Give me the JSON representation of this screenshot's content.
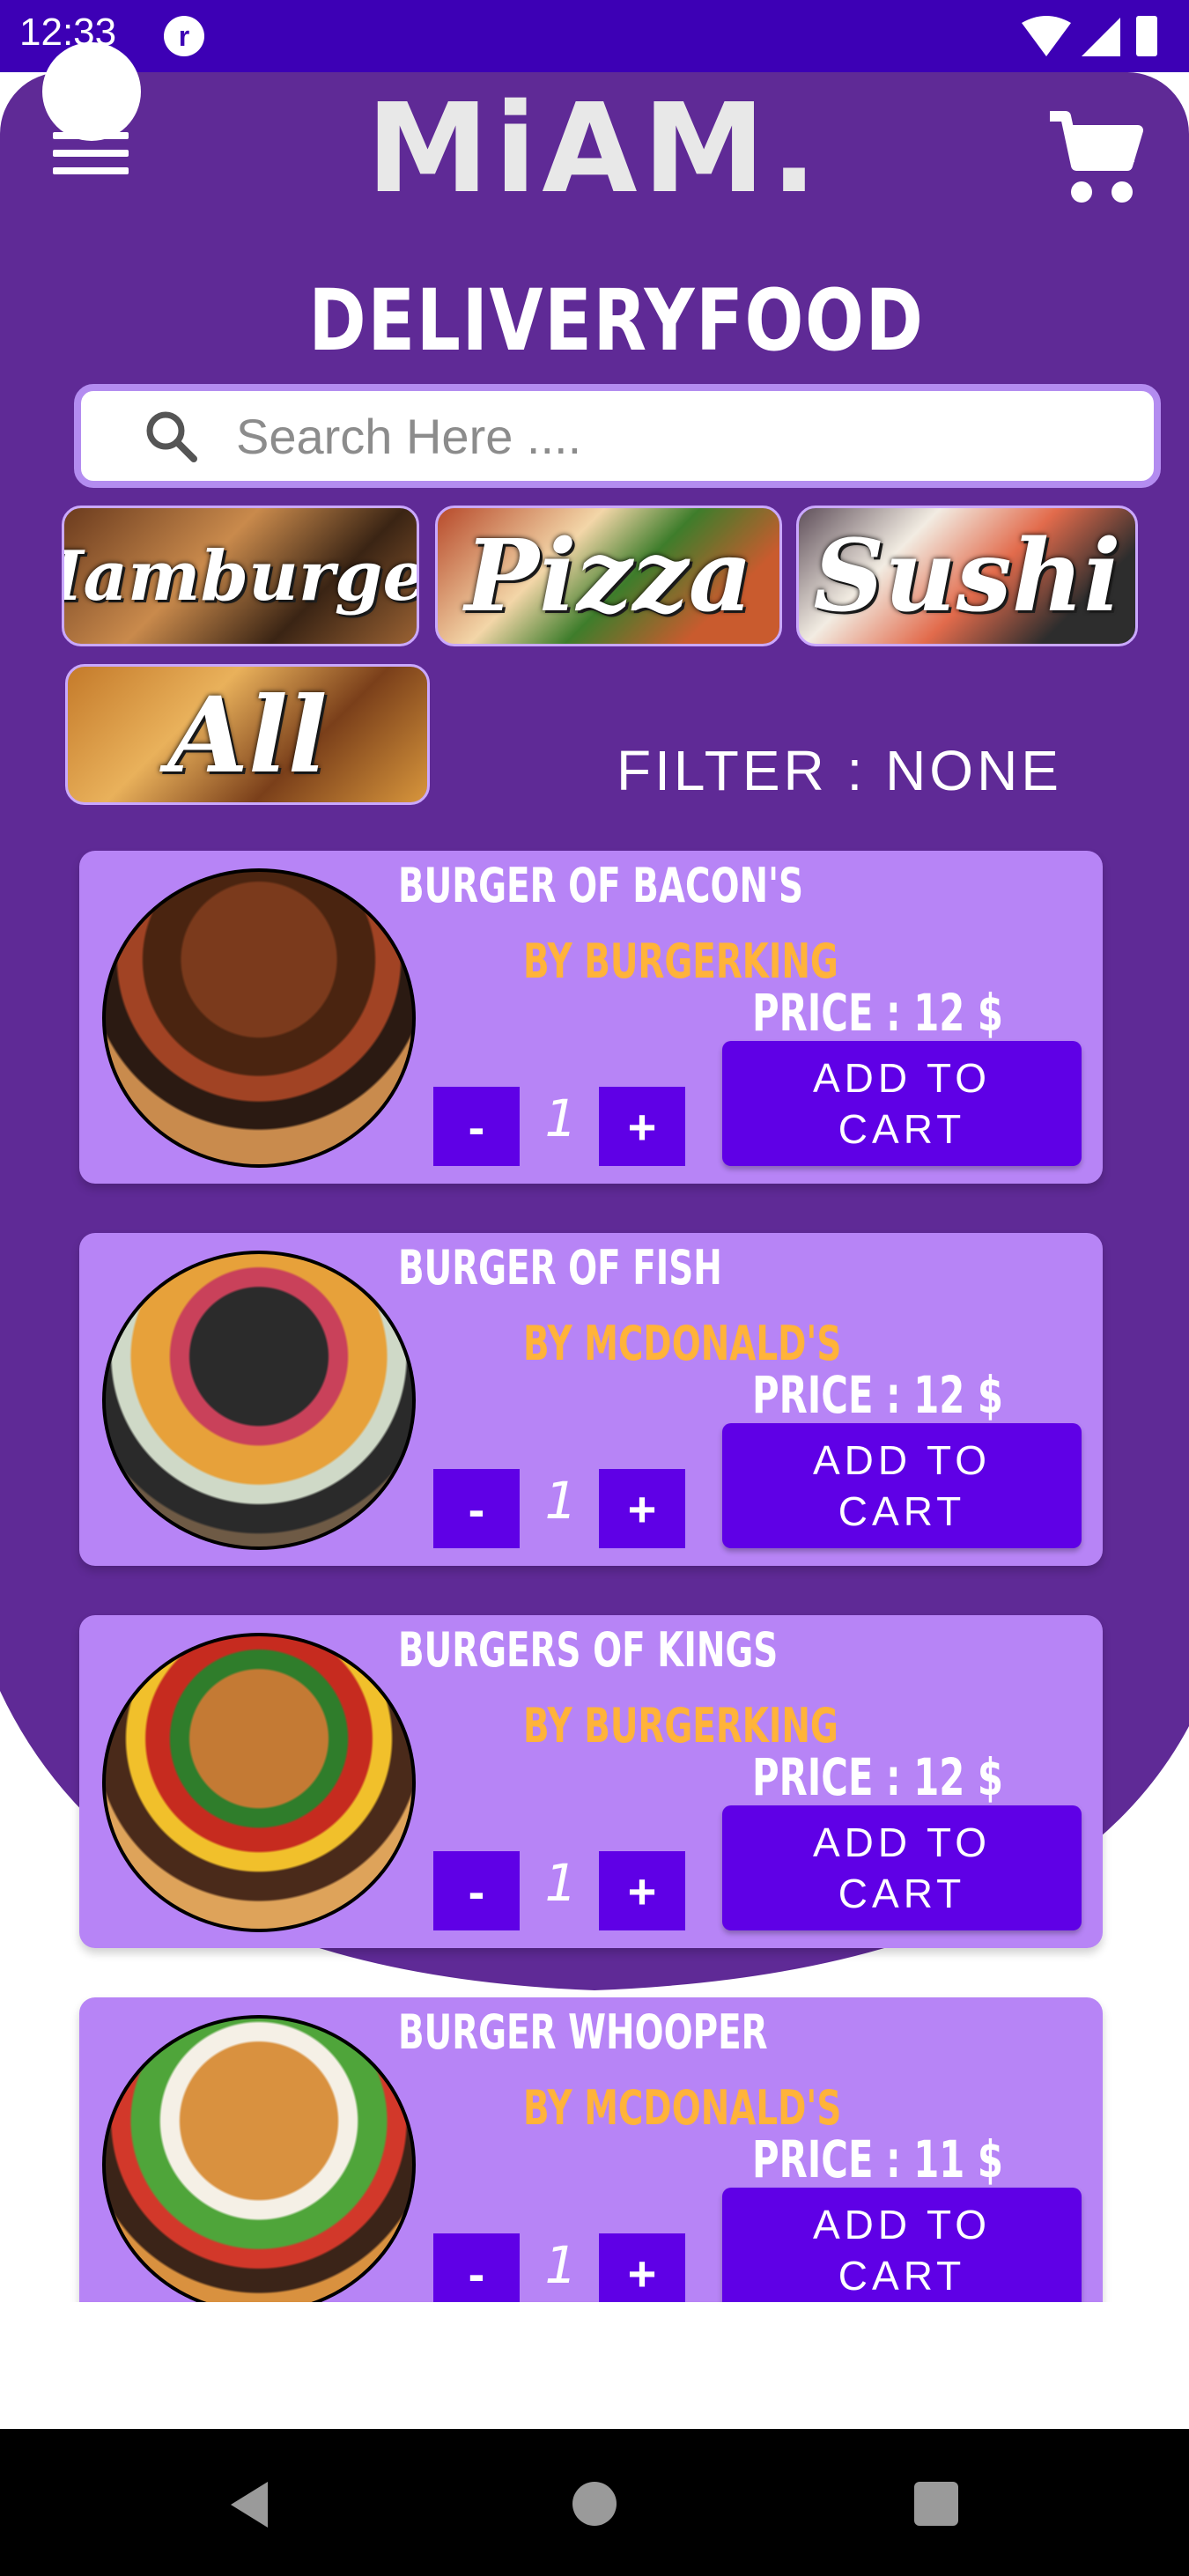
{
  "status_bar": {
    "time": "12:33",
    "app_badge": "r"
  },
  "header": {
    "logo": "MiAM.",
    "title": "DELIVERYFOOD"
  },
  "search": {
    "placeholder": "Search Here ...."
  },
  "categories": [
    {
      "label": "Hamburger"
    },
    {
      "label": "Pizza"
    },
    {
      "label": "Sushi"
    },
    {
      "label": "All"
    }
  ],
  "filter": {
    "text": "FILTER : NONE"
  },
  "products": [
    {
      "name": "BURGER OF BACON'S",
      "vendor": "BY BURGERKING",
      "price": "PRICE :  12 $",
      "qty": "1",
      "minus": "-",
      "plus": "+",
      "add_label": "ADD TO CART"
    },
    {
      "name": "BURGER OF FISH",
      "vendor": "BY MCDONALD'S",
      "price": "PRICE :  12 $",
      "qty": "1",
      "minus": "-",
      "plus": "+",
      "add_label": "ADD TO CART"
    },
    {
      "name": "BURGERS OF KINGS",
      "vendor": "BY BURGERKING",
      "price": "PRICE :  12 $",
      "qty": "1",
      "minus": "-",
      "plus": "+",
      "add_label": "ADD TO CART"
    },
    {
      "name": "BURGER WHOOPER",
      "vendor": "BY MCDONALD'S",
      "price": "PRICE :  11 $",
      "qty": "1",
      "minus": "-",
      "plus": "+",
      "add_label": "ADD TO CART"
    }
  ],
  "colors": {
    "primary": "#5f2a96",
    "button": "#5f00e6",
    "card": "#b784f6",
    "vendor": "#ffb33a",
    "status_bar": "#3d00b5"
  },
  "icons": {
    "menu": "hamburger-menu-icon",
    "cart": "cart-icon",
    "search": "search-icon",
    "back": "back-icon",
    "home": "home-icon",
    "recent": "recents-icon"
  }
}
